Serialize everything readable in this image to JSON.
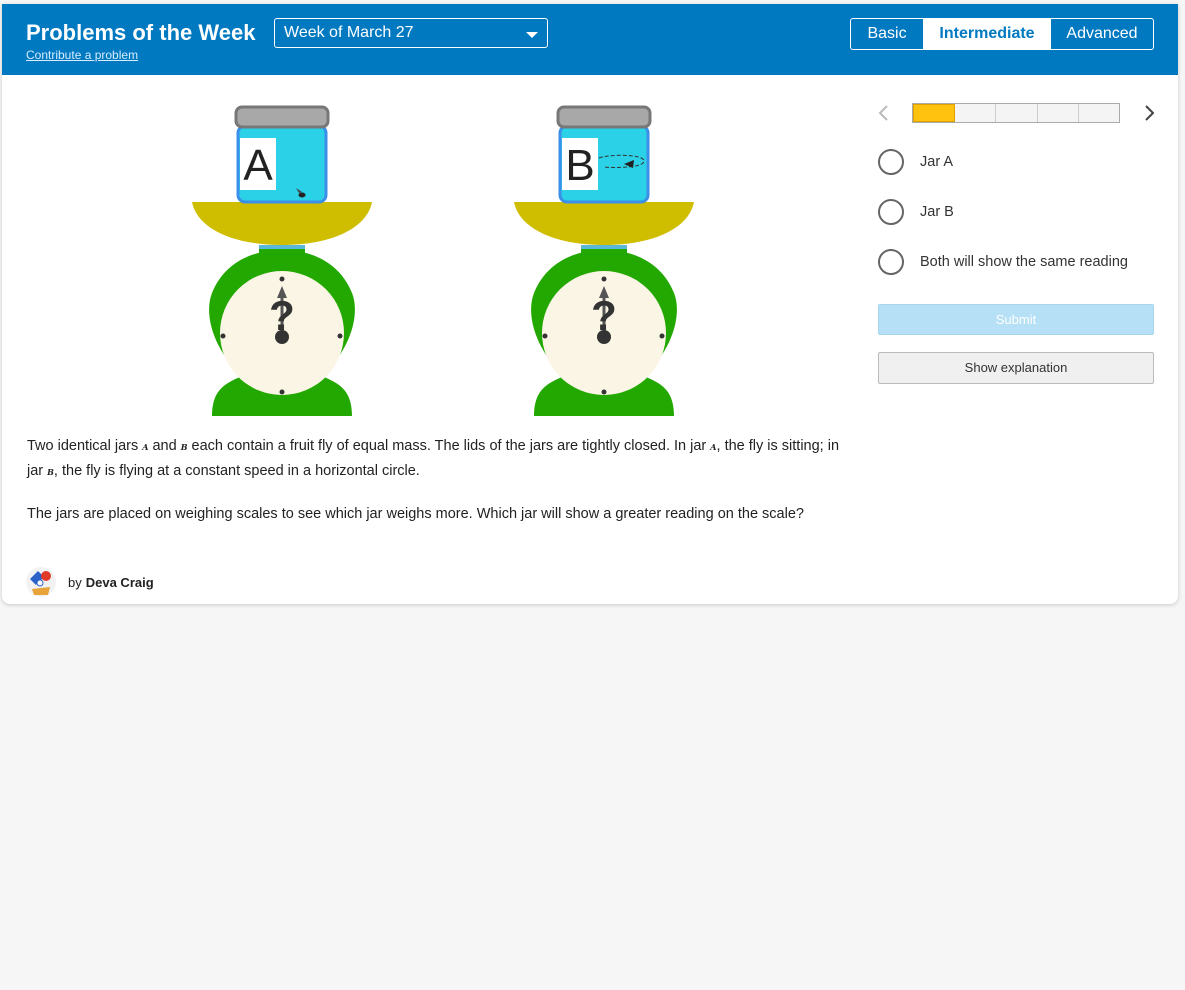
{
  "header": {
    "title": "Problems of the Week",
    "contribute_link": "Contribute a problem",
    "week_select": "Week of March 27",
    "levels": [
      "Basic",
      "Intermediate",
      "Advanced"
    ],
    "selected_level": "Intermediate"
  },
  "illustration": {
    "jar_a_label": "A",
    "jar_b_label": "B",
    "dial_symbol": "?"
  },
  "problem": {
    "p1_a": "Two identical jars ",
    "var_a": "A",
    "p1_b": " and ",
    "var_b": "B",
    "p1_c": " each contain a fruit fly of equal mass. The lids of the jars are tightly closed. In jar ",
    "var_a2": "A",
    "p1_d": ", the fly is sitting; in jar ",
    "var_b2": "B",
    "p1_e": ", the fly is flying at a constant speed in a horizontal circle.",
    "p2": "The jars are placed on weighing scales to see which jar weighs more. Which jar will show a greater reading on the scale?"
  },
  "author": {
    "by": "by",
    "name": "Deva Craig"
  },
  "progress": {
    "segments": 5,
    "current": 1
  },
  "options": [
    {
      "label": "Jar A"
    },
    {
      "label": "Jar B"
    },
    {
      "label": "Both will show the same reading"
    }
  ],
  "buttons": {
    "submit": "Submit",
    "explain": "Show explanation"
  },
  "colors": {
    "header_bg": "#0079c1",
    "scale_green": "#22a800",
    "pan_yellow": "#cfbd00",
    "jar_blue": "#2ad1e7",
    "progress_active": "#ffc20e"
  }
}
